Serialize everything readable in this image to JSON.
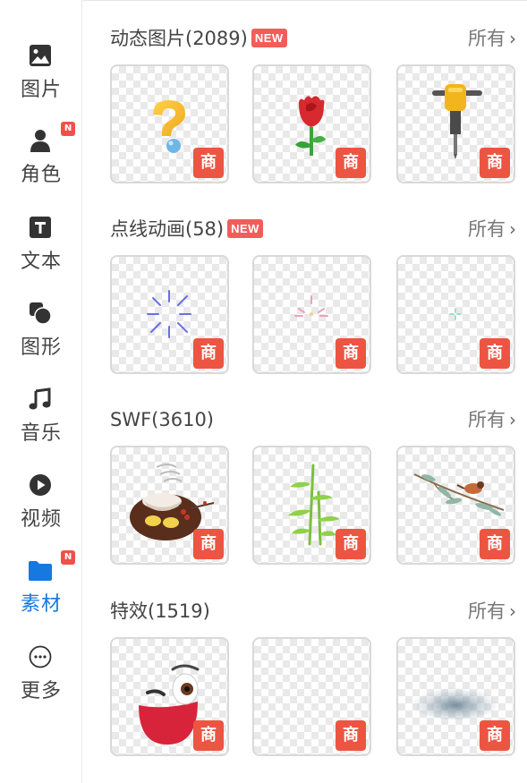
{
  "sidebar": {
    "items": [
      {
        "label": "图片",
        "icon": "image-icon",
        "new": false,
        "active": false
      },
      {
        "label": "角色",
        "icon": "person-icon",
        "new": true,
        "active": false
      },
      {
        "label": "文本",
        "icon": "text-icon",
        "new": false,
        "active": false
      },
      {
        "label": "图形",
        "icon": "shapes-icon",
        "new": false,
        "active": false
      },
      {
        "label": "音乐",
        "icon": "music-icon",
        "new": false,
        "active": false
      },
      {
        "label": "视频",
        "icon": "play-icon",
        "new": false,
        "active": false
      },
      {
        "label": "素材",
        "icon": "folder-icon",
        "new": true,
        "active": true
      },
      {
        "label": "更多",
        "icon": "more-icon",
        "new": false,
        "active": false
      }
    ],
    "new_dot": "N",
    "active_color": "#1778e0"
  },
  "sections": [
    {
      "title": "动态图片(2089)",
      "new_badge": "NEW",
      "see_all": "所有",
      "items": [
        {
          "art": "question-mark",
          "badge": "商"
        },
        {
          "art": "rose",
          "badge": "商"
        },
        {
          "art": "jackhammer",
          "badge": "商"
        }
      ]
    },
    {
      "title": "点线动画(58)",
      "new_badge": "NEW",
      "see_all": "所有",
      "items": [
        {
          "art": "burst-blue",
          "badge": "商"
        },
        {
          "art": "burst-pink",
          "badge": "商"
        },
        {
          "art": "sparkle-teal",
          "badge": "商"
        }
      ]
    },
    {
      "title": "SWF(3610)",
      "new_badge": "",
      "see_all": "所有",
      "items": [
        {
          "art": "hotpot",
          "badge": "商"
        },
        {
          "art": "bamboo",
          "badge": "商"
        },
        {
          "art": "bird-branch",
          "badge": "商"
        }
      ]
    },
    {
      "title": "特效(1519)",
      "new_badge": "",
      "see_all": "所有",
      "items": [
        {
          "art": "winking-face",
          "badge": "商"
        },
        {
          "art": "empty",
          "badge": "商"
        },
        {
          "art": "smoke",
          "badge": "商"
        }
      ]
    }
  ],
  "colors": {
    "new_badge": "#f25d5a",
    "commercial_badge": "#ec5542"
  }
}
